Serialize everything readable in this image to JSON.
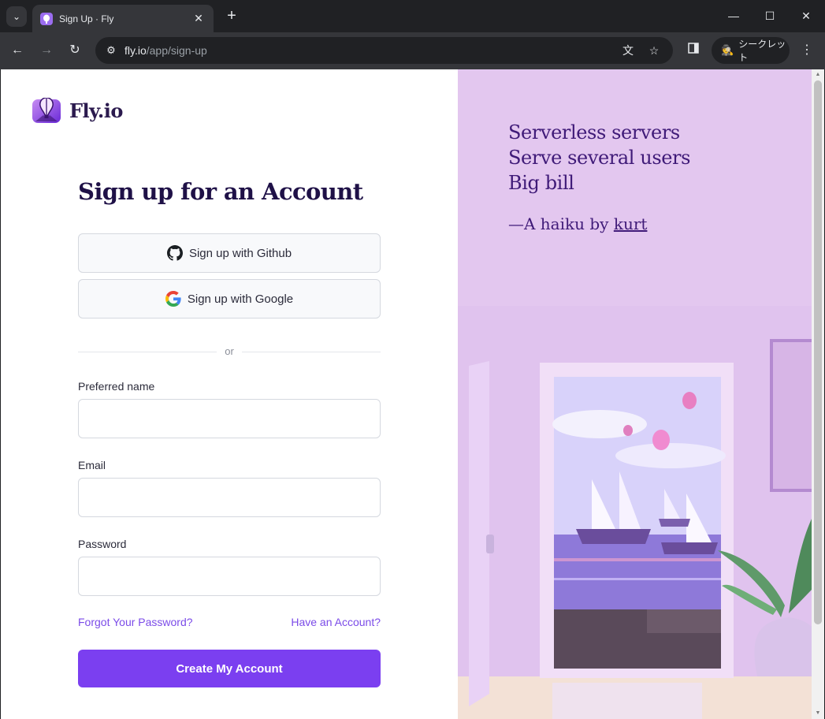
{
  "browser": {
    "tab": {
      "title": "Sign Up · Fly"
    },
    "url": {
      "host": "fly.io",
      "path": "/app/sign-up"
    },
    "incognito_label": "シークレット"
  },
  "page": {
    "brand": "Fly.io",
    "heading": "Sign up for an Account",
    "github_button": "Sign up with Github",
    "google_button": "Sign up with Google",
    "divider": "or",
    "fields": {
      "name": {
        "label": "Preferred name",
        "value": ""
      },
      "email": {
        "label": "Email",
        "value": ""
      },
      "password": {
        "label": "Password",
        "value": ""
      }
    },
    "forgot_link": "Forgot Your Password?",
    "have_account_link": "Have an Account?",
    "submit": "Create My Account",
    "accent_color": "#7b3ff0"
  },
  "haiku": {
    "lines": [
      "Serverless servers",
      "Serve several users",
      "Big bill"
    ],
    "byline_prefix": "—A haiku by ",
    "author": "kurt"
  },
  "icons": [
    "chevron-down-icon",
    "close-icon",
    "plus-icon",
    "minimize-icon",
    "maximize-icon",
    "back-icon",
    "forward-icon",
    "reload-icon",
    "tune-icon",
    "translate-icon",
    "star-icon",
    "side-panel-icon",
    "incognito-icon",
    "kebab-menu-icon",
    "github-icon",
    "google-icon",
    "balloon-icon"
  ]
}
